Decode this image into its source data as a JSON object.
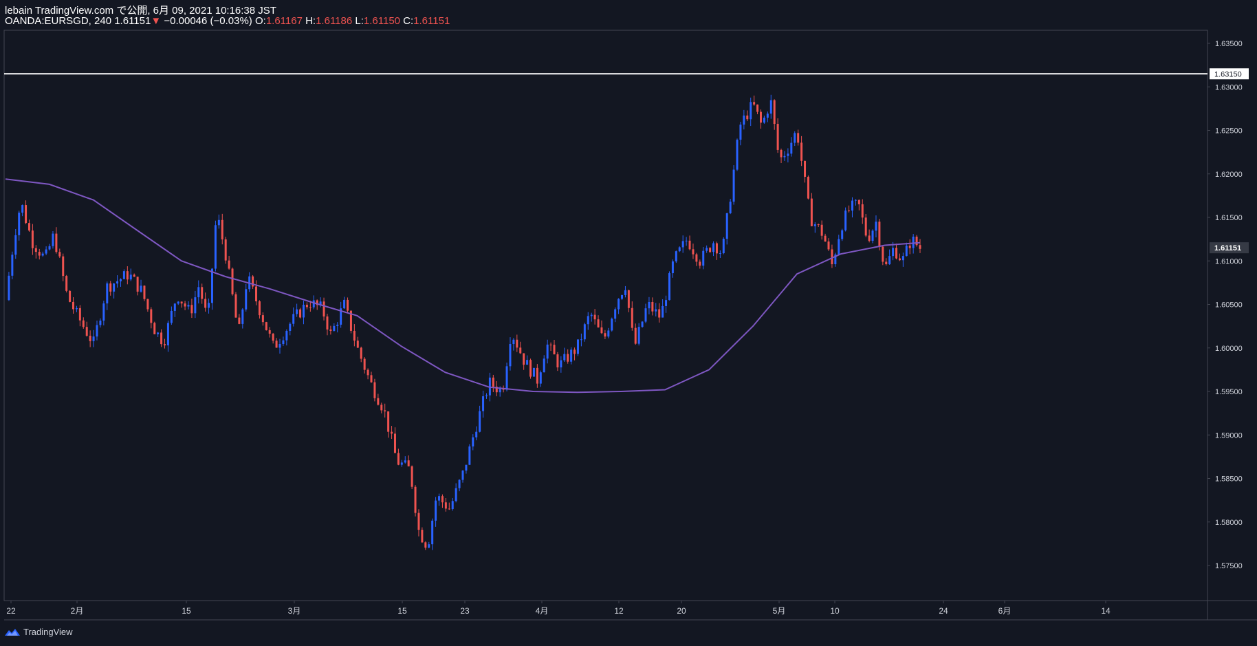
{
  "header": {
    "published": "lebain TradingView.com で公開, 6月 09, 2021 10:16:38 JST",
    "symbol": "OANDA:EURSGD, 240",
    "last": "1.61151",
    "change_arrow": "▼",
    "change": "−0.00046 (−0.03%)",
    "o_label": "O:",
    "o_value": "1.61167",
    "h_label": "H:",
    "h_value": "1.61186",
    "l_label": "L:",
    "l_value": "1.61150",
    "c_label": "C:",
    "c_value": "1.61151"
  },
  "footer": {
    "brand": "TradingView",
    "logo_icon": "tradingview-logo-icon"
  },
  "colors": {
    "background": "#131722",
    "up": "#2962ff",
    "down": "#ef5350",
    "ma": "#7e57c2",
    "hline": "#ffffff",
    "text": "#d1d4dc"
  },
  "chart_data": {
    "type": "candlestick",
    "symbol": "OANDA:EURSGD",
    "interval": "240",
    "ylim": [
      1.5715,
      1.6365
    ],
    "y_ticks": [
      "1.63500",
      "1.63000",
      "1.62500",
      "1.62000",
      "1.61500",
      "1.61000",
      "1.60500",
      "1.60000",
      "1.59500",
      "1.59000",
      "1.58500",
      "1.58000",
      "1.57500"
    ],
    "x_ticks": [
      "22",
      "2月",
      "15",
      "3月",
      "15",
      "23",
      "4月",
      "12",
      "20",
      "5月",
      "10",
      "24",
      "6月",
      "14"
    ],
    "horizontal_line": {
      "value": 1.6315,
      "label": "1.63150"
    },
    "last_price_label": "1.61151",
    "price_path": [
      {
        "t": 0,
        "p": 1.6055
      },
      {
        "t": 2,
        "p": 1.6128
      },
      {
        "t": 3.5,
        "p": 1.6168
      },
      {
        "t": 6,
        "p": 1.6123
      },
      {
        "t": 9,
        "p": 1.6102
      },
      {
        "t": 11,
        "p": 1.613
      },
      {
        "t": 14,
        "p": 1.606
      },
      {
        "t": 16,
        "p": 1.604
      },
      {
        "t": 20,
        "p": 1.6005
      },
      {
        "t": 23,
        "p": 1.607
      },
      {
        "t": 28,
        "p": 1.6085
      },
      {
        "t": 31,
        "p": 1.6065
      },
      {
        "t": 34,
        "p": 1.602
      },
      {
        "t": 36,
        "p": 1.6007
      },
      {
        "t": 39,
        "p": 1.6062
      },
      {
        "t": 42,
        "p": 1.604
      },
      {
        "t": 44,
        "p": 1.6072
      },
      {
        "t": 46,
        "p": 1.603
      },
      {
        "t": 48,
        "p": 1.6155
      },
      {
        "t": 50,
        "p": 1.611
      },
      {
        "t": 53,
        "p": 1.6015
      },
      {
        "t": 55,
        "p": 1.6082
      },
      {
        "t": 57,
        "p": 1.6055
      },
      {
        "t": 61,
        "p": 1.6
      },
      {
        "t": 65,
        "p": 1.603
      },
      {
        "t": 69,
        "p": 1.6053
      },
      {
        "t": 72,
        "p": 1.6045
      },
      {
        "t": 74,
        "p": 1.6015
      },
      {
        "t": 77,
        "p": 1.605
      },
      {
        "t": 80,
        "p": 1.6
      },
      {
        "t": 83,
        "p": 1.596
      },
      {
        "t": 86,
        "p": 1.593
      },
      {
        "t": 89,
        "p": 1.587
      },
      {
        "t": 92,
        "p": 1.586
      },
      {
        "t": 94,
        "p": 1.579
      },
      {
        "t": 96,
        "p": 1.5772
      },
      {
        "t": 98,
        "p": 1.583
      },
      {
        "t": 101,
        "p": 1.5815
      },
      {
        "t": 104,
        "p": 1.5855
      },
      {
        "t": 107,
        "p": 1.591
      },
      {
        "t": 110,
        "p": 1.596
      },
      {
        "t": 113,
        "p": 1.595
      },
      {
        "t": 115,
        "p": 1.602
      },
      {
        "t": 118,
        "p": 1.5985
      },
      {
        "t": 121,
        "p": 1.5963
      },
      {
        "t": 123,
        "p": 1.6005
      },
      {
        "t": 126,
        "p": 1.598
      },
      {
        "t": 130,
        "p": 1.6
      },
      {
        "t": 133,
        "p": 1.604
      },
      {
        "t": 136,
        "p": 1.6008
      },
      {
        "t": 139,
        "p": 1.6055
      },
      {
        "t": 141,
        "p": 1.6073
      },
      {
        "t": 143,
        "p": 1.6
      },
      {
        "t": 146,
        "p": 1.605
      },
      {
        "t": 149,
        "p": 1.6035
      },
      {
        "t": 152,
        "p": 1.61
      },
      {
        "t": 155,
        "p": 1.6125
      },
      {
        "t": 158,
        "p": 1.61
      },
      {
        "t": 161,
        "p": 1.6122
      },
      {
        "t": 163,
        "p": 1.6108
      },
      {
        "t": 165,
        "p": 1.618
      },
      {
        "t": 167,
        "p": 1.6255
      },
      {
        "t": 170,
        "p": 1.628
      },
      {
        "t": 172,
        "p": 1.6255
      },
      {
        "t": 174,
        "p": 1.6285
      },
      {
        "t": 176,
        "p": 1.6215
      },
      {
        "t": 178,
        "p": 1.623
      },
      {
        "t": 180,
        "p": 1.625
      },
      {
        "t": 183,
        "p": 1.615
      },
      {
        "t": 186,
        "p": 1.613
      },
      {
        "t": 188,
        "p": 1.6095
      },
      {
        "t": 190,
        "p": 1.614
      },
      {
        "t": 192,
        "p": 1.616
      },
      {
        "t": 194,
        "p": 1.6165
      },
      {
        "t": 196,
        "p": 1.6125
      },
      {
        "t": 198,
        "p": 1.6145
      },
      {
        "t": 200,
        "p": 1.609
      },
      {
        "t": 202,
        "p": 1.6115
      },
      {
        "t": 204,
        "p": 1.61
      },
      {
        "t": 206,
        "p": 1.6125
      },
      {
        "t": 208,
        "p": 1.6115
      }
    ],
    "moving_average": [
      {
        "t": 0,
        "p": 1.6194
      },
      {
        "t": 10,
        "p": 1.6188
      },
      {
        "t": 20,
        "p": 1.617
      },
      {
        "t": 30,
        "p": 1.6135
      },
      {
        "t": 40,
        "p": 1.61
      },
      {
        "t": 50,
        "p": 1.6082
      },
      {
        "t": 60,
        "p": 1.6068
      },
      {
        "t": 70,
        "p": 1.6052
      },
      {
        "t": 80,
        "p": 1.6037
      },
      {
        "t": 90,
        "p": 1.6002
      },
      {
        "t": 100,
        "p": 1.5972
      },
      {
        "t": 110,
        "p": 1.5955
      },
      {
        "t": 120,
        "p": 1.595
      },
      {
        "t": 130,
        "p": 1.5949
      },
      {
        "t": 140,
        "p": 1.595
      },
      {
        "t": 150,
        "p": 1.5952
      },
      {
        "t": 160,
        "p": 1.5975
      },
      {
        "t": 170,
        "p": 1.6025
      },
      {
        "t": 180,
        "p": 1.6085
      },
      {
        "t": 190,
        "p": 1.6108
      },
      {
        "t": 200,
        "p": 1.6118
      },
      {
        "t": 208,
        "p": 1.6121
      }
    ]
  }
}
